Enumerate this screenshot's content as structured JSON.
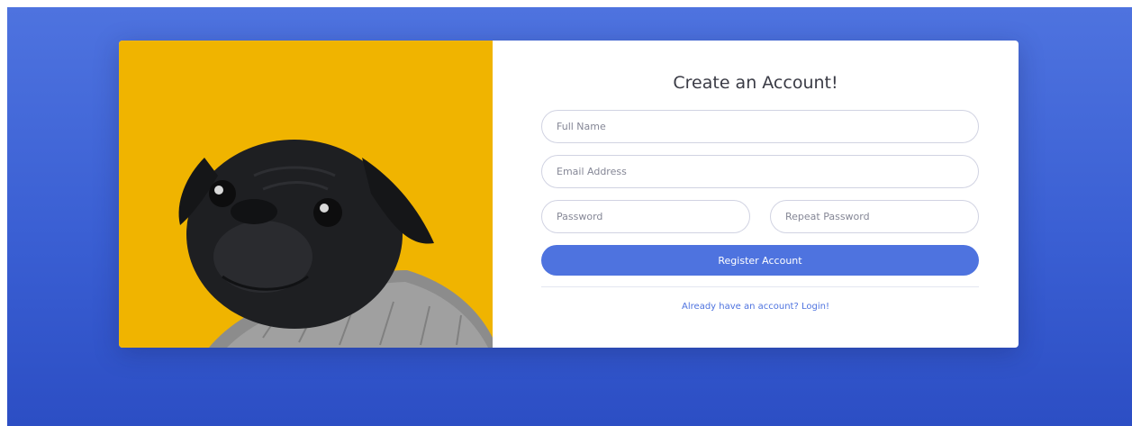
{
  "form": {
    "title": "Create an Account!",
    "full_name_placeholder": "Full Name",
    "email_placeholder": "Email Address",
    "password_placeholder": "Password",
    "repeat_password_placeholder": "Repeat Password",
    "register_label": "Register Account",
    "login_link": "Already have an account? Login!"
  },
  "image": {
    "subject": "pug-in-sweater"
  },
  "colors": {
    "primary": "#4e73df",
    "photo_bg": "#f0b400",
    "text": "#3a3b45"
  }
}
